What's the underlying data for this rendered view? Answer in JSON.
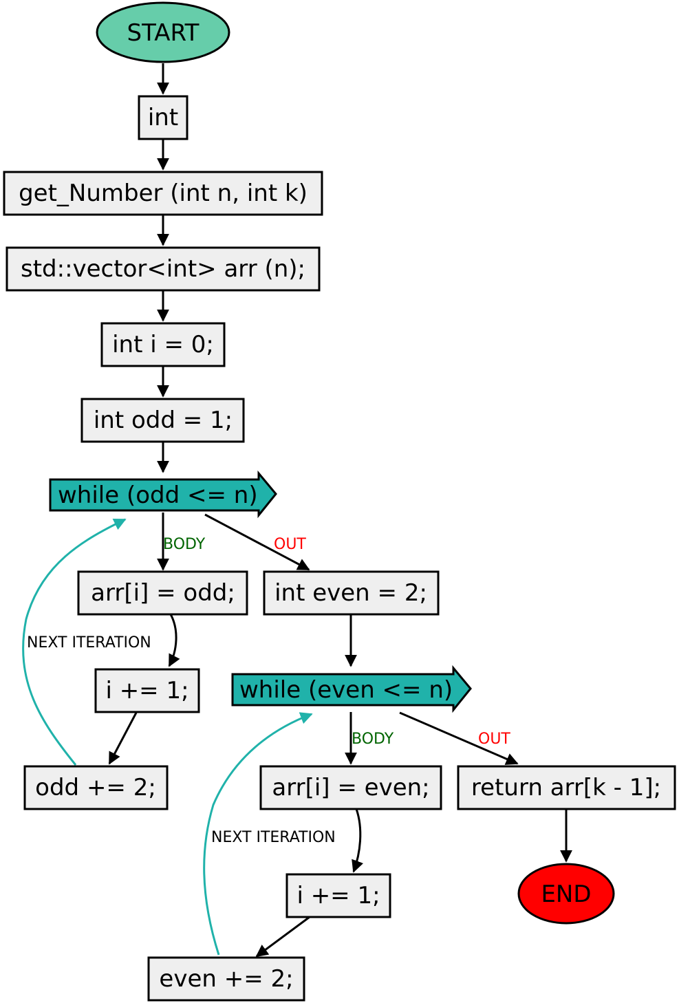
{
  "nodes": {
    "start": "START",
    "int": "int",
    "signature": "get_Number (int n, int k)",
    "vector": "std::vector<int> arr (n);",
    "init_i": "int i = 0;",
    "init_odd": "int odd = 1;",
    "while_odd": "while (odd <= n)",
    "assign_odd": "arr[i] = odd;",
    "inc_i_1": "i += 1;",
    "inc_odd": "odd += 2;",
    "init_even": "int even = 2;",
    "while_even": "while (even <= n)",
    "assign_even": "arr[i] = even;",
    "inc_i_2": "i += 1;",
    "inc_even": "even += 2;",
    "ret": "return arr[k - 1];",
    "end": "END"
  },
  "edge_labels": {
    "body": "BODY",
    "out": "OUT",
    "next_iteration": "NEXT ITERATION"
  },
  "colors": {
    "start": "#66cdaa",
    "end": "#ff0000",
    "loop": "#20b2aa",
    "box": "#efefef",
    "body_label": "#006400",
    "out_label": "#ff0000",
    "back_edge": "#20b2aa"
  }
}
